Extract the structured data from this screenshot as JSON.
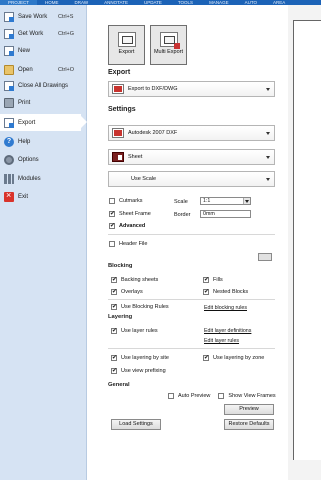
{
  "ribbon": {
    "tabs": [
      "PROJECT",
      "HOME",
      "DRAW",
      "ANNOTATE",
      "UPDATE",
      "TOOLS",
      "MANAGE",
      "AUTO",
      "AREA"
    ]
  },
  "sidebar": {
    "items": [
      {
        "label": "Save Work",
        "shortcut": "Ctrl+S",
        "icon": "save-icon"
      },
      {
        "label": "Get Work",
        "shortcut": "Ctrl+G",
        "icon": "get-work-icon"
      },
      {
        "label": "New",
        "shortcut": "",
        "icon": "new-document-icon"
      },
      {
        "label": "Open",
        "shortcut": "Ctrl+O",
        "icon": "open-folder-icon"
      },
      {
        "label": "Close All Drawings",
        "shortcut": "",
        "icon": "close-drawings-icon"
      },
      {
        "label": "Print",
        "shortcut": "",
        "icon": "printer-icon"
      },
      {
        "label": "Export",
        "shortcut": "",
        "icon": "export-icon"
      },
      {
        "label": "Help",
        "shortcut": "",
        "icon": "help-icon"
      },
      {
        "label": "Options",
        "shortcut": "",
        "icon": "gear-icon"
      },
      {
        "label": "Modules",
        "shortcut": "",
        "icon": "modules-icon"
      },
      {
        "label": "Exit",
        "shortcut": "",
        "icon": "exit-icon"
      }
    ],
    "active": "Export"
  },
  "toolbar": {
    "export_label": "Export",
    "multi_export_label": "Multi Export"
  },
  "export": {
    "heading": "Export",
    "target": "Export to DXF/DWG"
  },
  "settings": {
    "heading": "Settings",
    "format": "Autodesk 2007 DXF",
    "source": "Sheet",
    "scale_mode": "Use Scale",
    "cutmarks_label": "Cutmarks",
    "cutmarks_checked": false,
    "scale_label": "Scale",
    "scale_value": "1:1",
    "sheet_frame_label": "Sheet Frame",
    "sheet_frame_checked": true,
    "border_label": "Border",
    "border_value": "0mm",
    "advanced_label": "Advanced",
    "advanced_checked": true,
    "header_file_label": "Header File",
    "header_file_checked": false
  },
  "blocking": {
    "heading": "Blocking",
    "backing_sheets_label": "Backing sheets",
    "backing_sheets_checked": true,
    "fills_label": "Fills",
    "fills_checked": true,
    "overlays_label": "Overlays",
    "overlays_checked": true,
    "nested_blocks_label": "Nested Blocks",
    "nested_blocks_checked": true,
    "use_blocking_rules_label": "Use Blocking Rules",
    "use_blocking_rules_checked": true,
    "edit_blocking_rules_link": "Edit blocking rules"
  },
  "layering": {
    "heading": "Layering",
    "use_layer_rules_label": "Use layer rules",
    "use_layer_rules_checked": true,
    "edit_layer_definitions_link": "Edit layer definitions",
    "edit_layer_rules_link": "Edit layer rules",
    "use_layering_by_site_label": "Use layering by site",
    "use_layering_by_site_checked": true,
    "use_layering_by_zone_label": "Use layering by zone",
    "use_layering_by_zone_checked": true,
    "use_view_prefixing_label": "Use view prefixing",
    "use_view_prefixing_checked": true
  },
  "general": {
    "heading": "General",
    "auto_preview_label": "Auto Preview",
    "auto_preview_checked": false,
    "show_view_frames_label": "Show View Frames",
    "show_view_frames_checked": false,
    "preview_button": "Preview",
    "load_settings_button": "Load Settings",
    "restore_defaults_button": "Restore Defaults"
  }
}
